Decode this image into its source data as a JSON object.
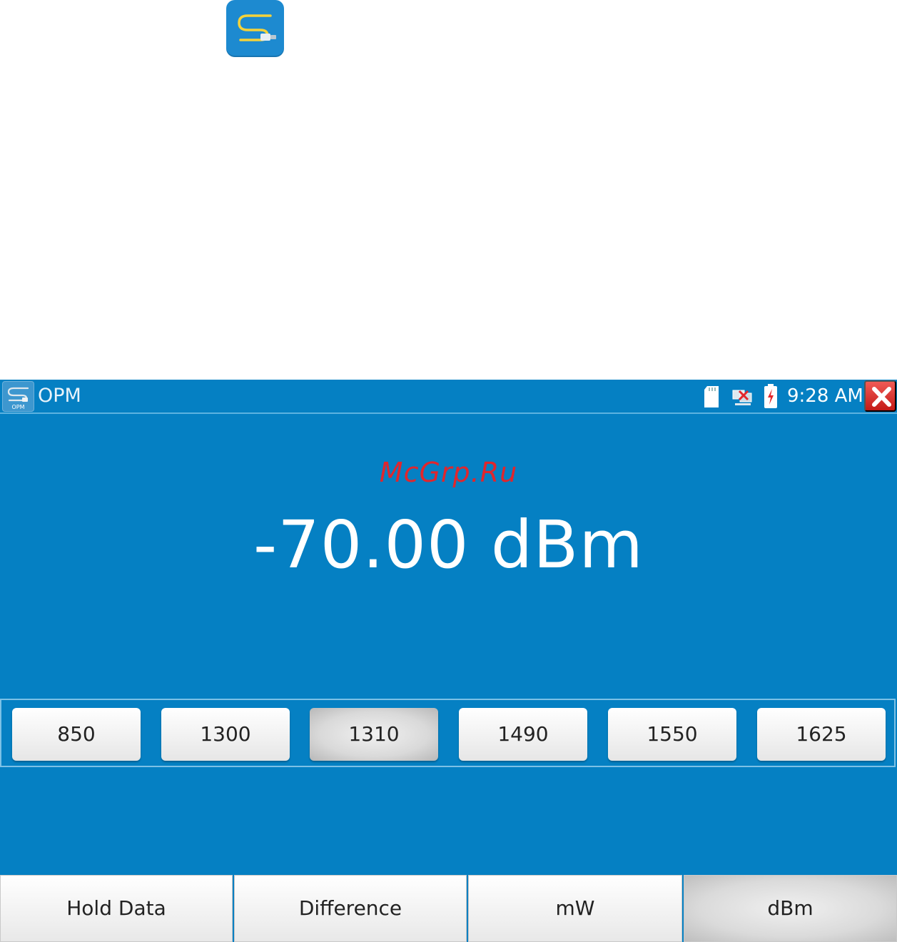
{
  "header": {
    "app_title": "OPM",
    "app_icon_label": "OPM",
    "clock": "9:28 AM"
  },
  "status_icons": [
    "sd-card-icon",
    "network-disconnected-icon",
    "battery-charging-icon"
  ],
  "watermark": "McGrp.Ru",
  "reading": {
    "value": "-70.00",
    "unit": "dBm",
    "display": "-70.00 dBm"
  },
  "wavelengths": {
    "options": [
      "850",
      "1300",
      "1310",
      "1490",
      "1550",
      "1625"
    ],
    "selected": "1310"
  },
  "bottom_toolbar": {
    "hold_data": "Hold Data",
    "difference": "Difference",
    "mw": "mW",
    "dbm": "dBm",
    "selected": "dBm"
  },
  "colors": {
    "screen_background": "#0580c3",
    "close_button": "#d9302c",
    "watermark": "#e0262d"
  }
}
